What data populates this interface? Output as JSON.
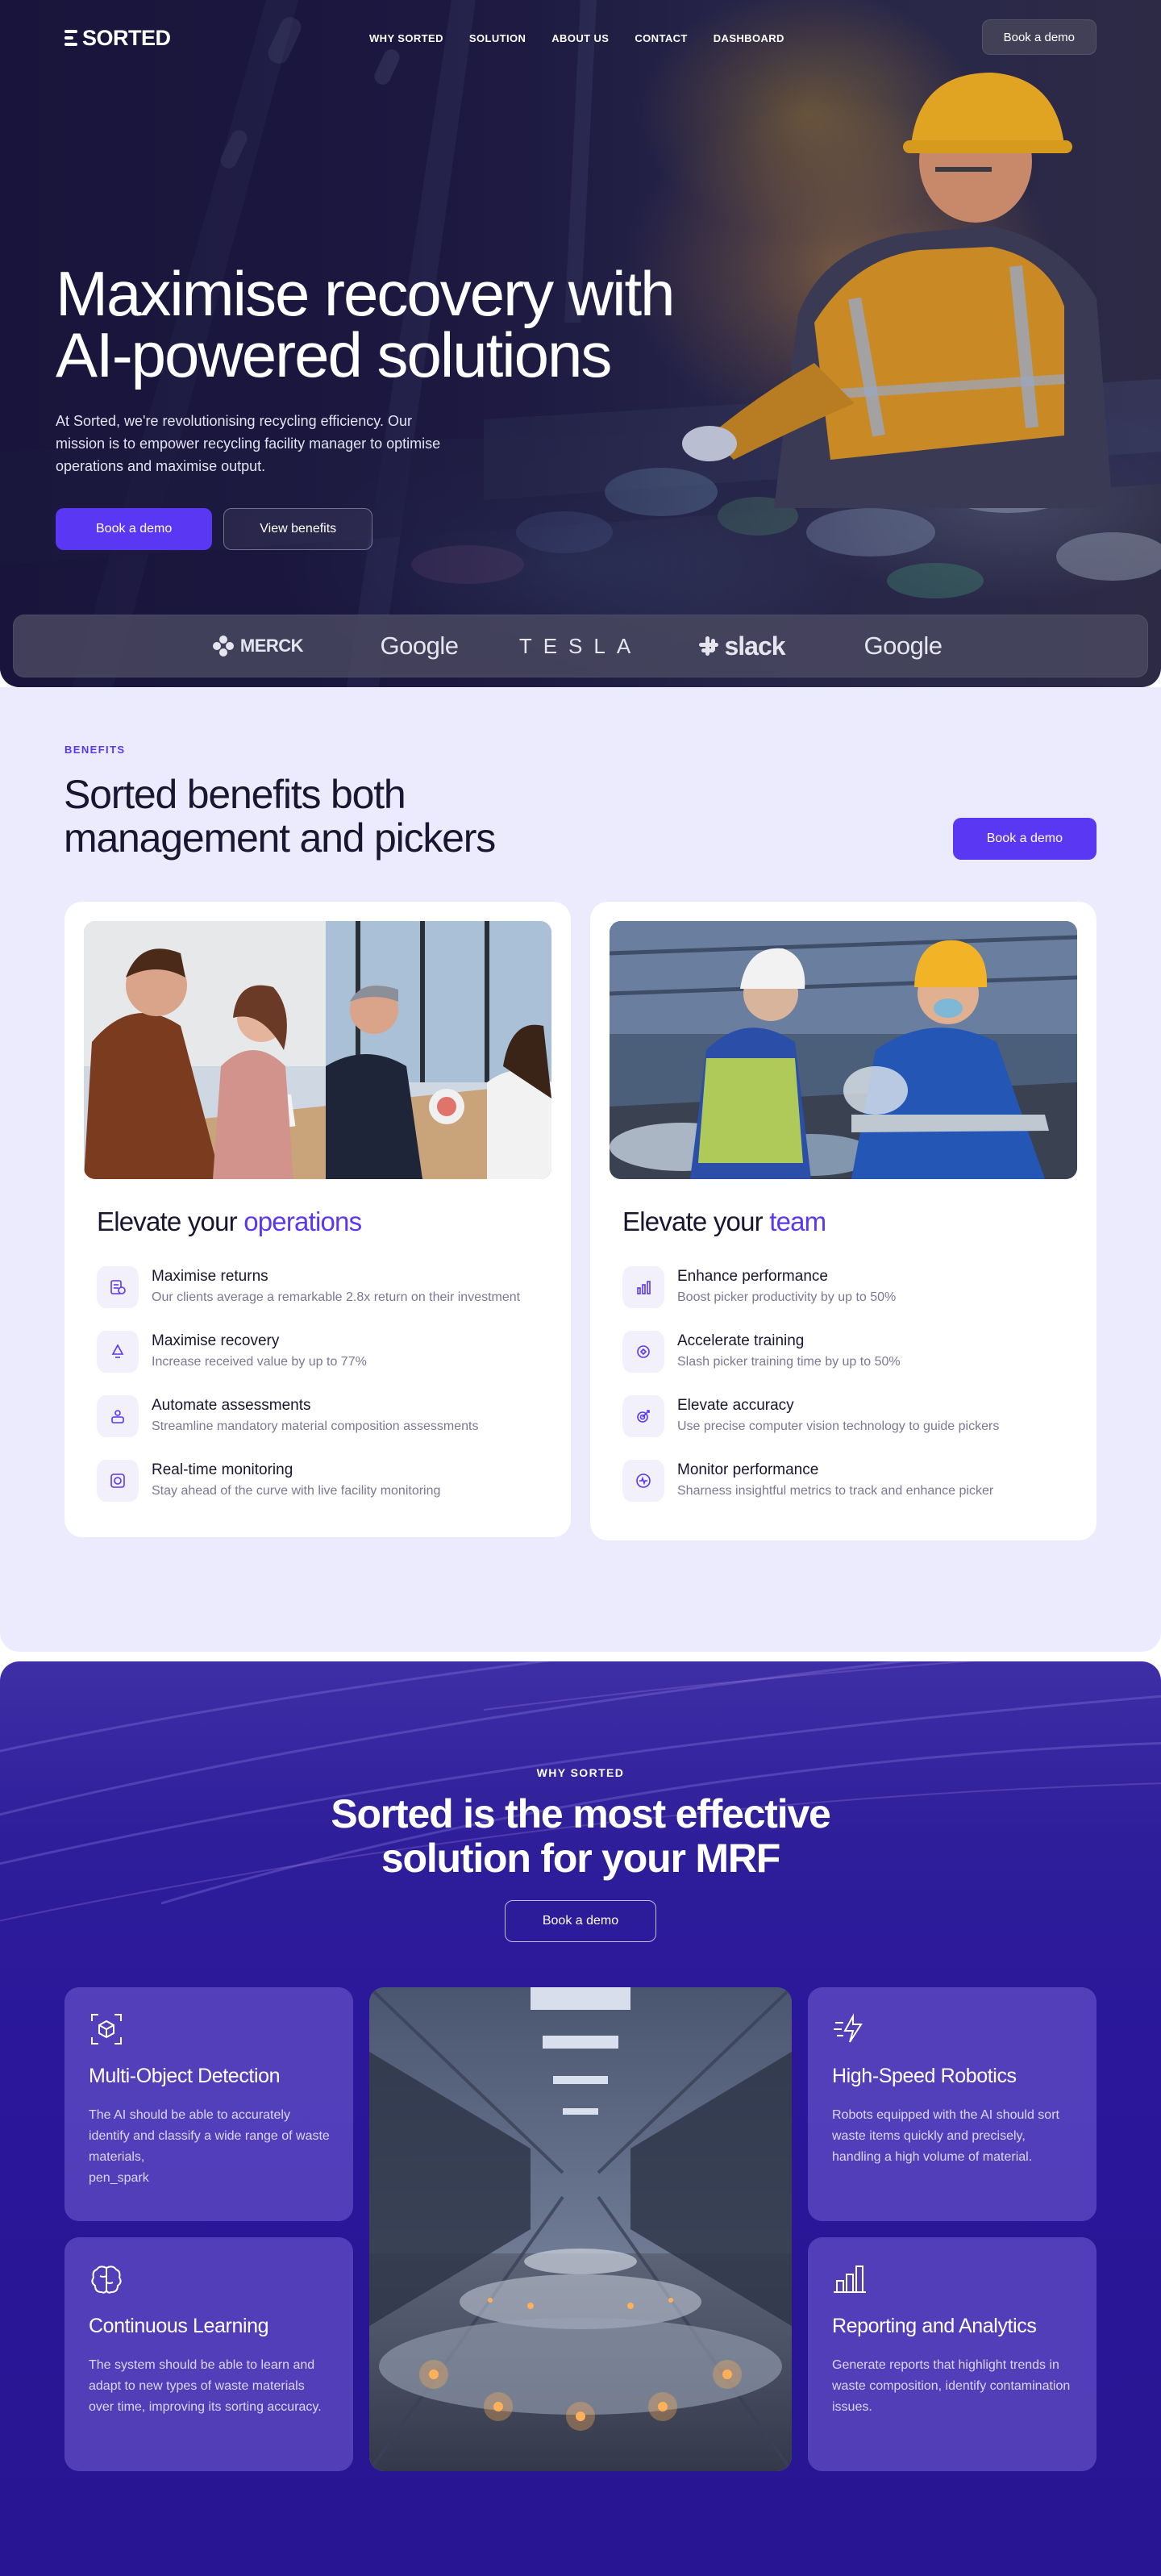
{
  "brand": {
    "name": "SORTED"
  },
  "nav": {
    "links": [
      "WHY SORTED",
      "SOLUTION",
      "ABOUT US",
      "CONTACT",
      "DASHBOARD"
    ],
    "cta": "Book a demo"
  },
  "hero": {
    "title_line1": "Maximise recovery with",
    "title_line2": "AI-powered solutions",
    "subtitle": "At Sorted, we're revolutionising recycling efficiency. Our mission is to empower recycling facility manager to optimise operations and maximise output.",
    "primary_cta": "Book a demo",
    "secondary_cta": "View benefits"
  },
  "partners": [
    "MERCK",
    "Google",
    "TESLA",
    "slack",
    "Google"
  ],
  "benefits": {
    "eyebrow": "BENEFITS",
    "title_line1": "Sorted benefits both",
    "title_line2": "management and pickers",
    "cta": "Book a demo",
    "cards": [
      {
        "heading_prefix": "Elevate your ",
        "heading_accent": "operations",
        "items": [
          {
            "icon": "returns-icon",
            "title": "Maximise returns",
            "desc": "Our clients average a remarkable 2.8x return on their investment"
          },
          {
            "icon": "recycle-icon",
            "title": "Maximise recovery",
            "desc": "Increase received value by up to 77%"
          },
          {
            "icon": "assessment-icon",
            "title": "Automate assessments",
            "desc": "Streamline mandatory material composition assessments"
          },
          {
            "icon": "monitoring-icon",
            "title": "Real-time monitoring",
            "desc": "Stay ahead of the curve with live facility monitoring"
          }
        ]
      },
      {
        "heading_prefix": "Elevate your ",
        "heading_accent": "team",
        "items": [
          {
            "icon": "bar-chart-icon",
            "title": "Enhance performance",
            "desc": "Boost picker productivity by up to 50%"
          },
          {
            "icon": "training-icon",
            "title": "Accelerate training",
            "desc": "Slash picker training time by up to 50%"
          },
          {
            "icon": "target-icon",
            "title": "Elevate accuracy",
            "desc": "Use precise computer vision technology to guide pickers"
          },
          {
            "icon": "pulse-icon",
            "title": "Monitor performance",
            "desc": "Sharness insightful metrics to track and enhance picker"
          }
        ]
      }
    ]
  },
  "why": {
    "eyebrow": "WHY SORTED",
    "title_line1": "Sorted is the most effective",
    "title_line2": "solution for your MRF",
    "cta": "Book a demo",
    "features": [
      {
        "icon": "cube-scan-icon",
        "title": "Multi-Object Detection",
        "desc": "The AI should be able to accurately identify and classify a wide range of waste materials,",
        "extra": "pen_spark"
      },
      {
        "icon": "brain-icon",
        "title": "Continuous Learning",
        "desc": "The system should be able to learn and adapt to new types of waste materials over time, improving its sorting accuracy.",
        "extra": ""
      },
      {
        "icon": "fast-bolt-icon",
        "title": "High-Speed Robotics",
        "desc": "Robots equipped with the AI should sort waste items quickly and precisely, handling a high volume of material.",
        "extra": ""
      },
      {
        "icon": "bar-chart-icon",
        "title": "Reporting and Analytics",
        "desc": "Generate reports that  highlight trends in waste composition, identify contamination issues.",
        "extra": ""
      }
    ]
  },
  "colors": {
    "accent": "#5a37f2",
    "hero_bg": "#1b1740",
    "benefits_bg": "#ecebfd",
    "why_bg": "#2a179a"
  }
}
